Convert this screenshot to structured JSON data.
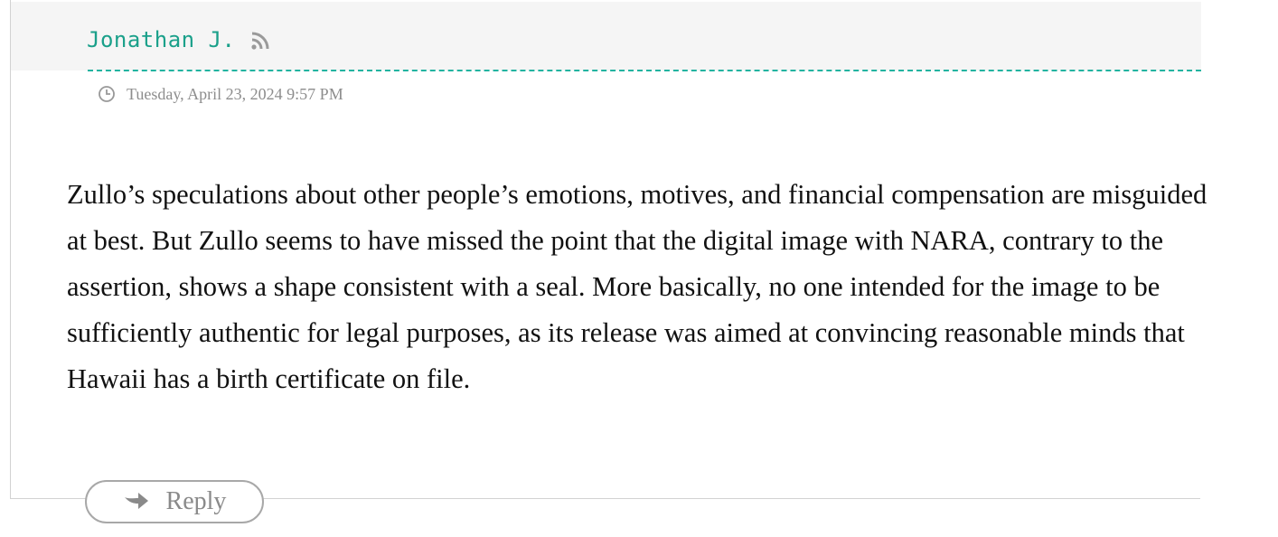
{
  "comment": {
    "author": "Jonathan J.",
    "timestamp": "Tuesday, April 23, 2024 9:57 PM",
    "body": "Zullo’s speculations about other people’s emotions, motives, and financial compensation are misguided at best. But Zullo seems to have missed the point that the digital image with NARA, contrary to the assertion, shows a shape consistent with a seal. More basically, no one intended for the image to be sufficiently authentic for legal purposes, as its release was aimed at convincing reasonable minds that Hawaii has a birth certificate on file.",
    "reply_label": "Reply"
  },
  "icons": {
    "feed": "rss-icon",
    "time": "clock-icon",
    "reply": "reply-arrow-icon"
  },
  "colors": {
    "author": "#1aa08a",
    "header_bg": "#f5f5f5",
    "meta_text": "#8d8d8d",
    "body_text": "#111111",
    "border": "#d2d2d2"
  }
}
